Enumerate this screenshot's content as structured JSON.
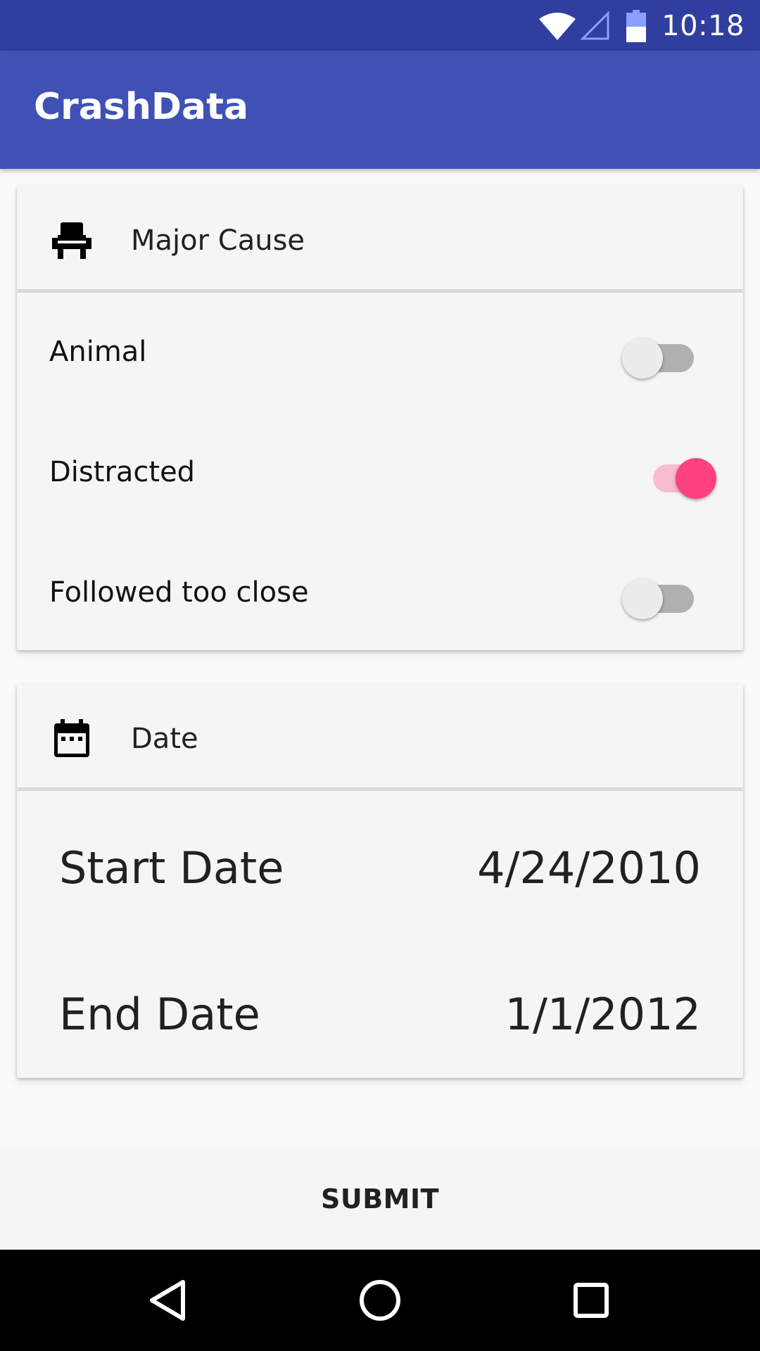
{
  "status_bar": {
    "time": "10:18",
    "icons": [
      "wifi-icon",
      "cell-signal-icon",
      "battery-icon"
    ]
  },
  "app_bar": {
    "title": "CrashData",
    "color": "#3f51b5"
  },
  "major_cause_card": {
    "icon": "car-seat-icon",
    "title": "Major Cause",
    "toggles": [
      {
        "label": "Animal",
        "checked": false
      },
      {
        "label": "Distracted",
        "checked": true
      },
      {
        "label": "Followed too close",
        "checked": false
      }
    ]
  },
  "date_card": {
    "icon": "calendar-icon",
    "title": "Date",
    "start": {
      "label": "Start Date",
      "value": "4/24/2010"
    },
    "end": {
      "label": "End Date",
      "value": "1/1/2012"
    }
  },
  "submit": {
    "label": "SUBMIT"
  },
  "nav_bar": {
    "icons": [
      "back-icon",
      "home-icon",
      "recents-icon"
    ]
  },
  "colors": {
    "primary": "#3f51b5",
    "primary_dark": "#303f9f",
    "accent": "#ff4081"
  }
}
